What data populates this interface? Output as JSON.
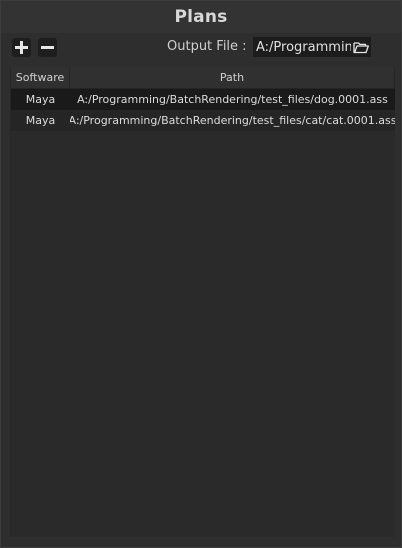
{
  "panel": {
    "title": "Plans"
  },
  "toolbar": {
    "add_icon": "plus-icon",
    "remove_icon": "minus-icon",
    "output_label": "Output File :",
    "output_value": "A:/Programming",
    "browse_icon": "folder-open-icon"
  },
  "table": {
    "columns": [
      "Software",
      "Path"
    ],
    "rows": [
      {
        "software": "Maya",
        "path": "A:/Programming/BatchRendering/test_files/dog.0001.ass"
      },
      {
        "software": "Maya",
        "path": "A:/Programming/BatchRendering/test_files/cat/cat.0001.ass"
      }
    ]
  },
  "colors": {
    "background": "#2e2e2e",
    "title_bar": "#333333",
    "field": "#1c1c1c",
    "row_dark": "#1a1a1a",
    "row_light": "#252525"
  }
}
